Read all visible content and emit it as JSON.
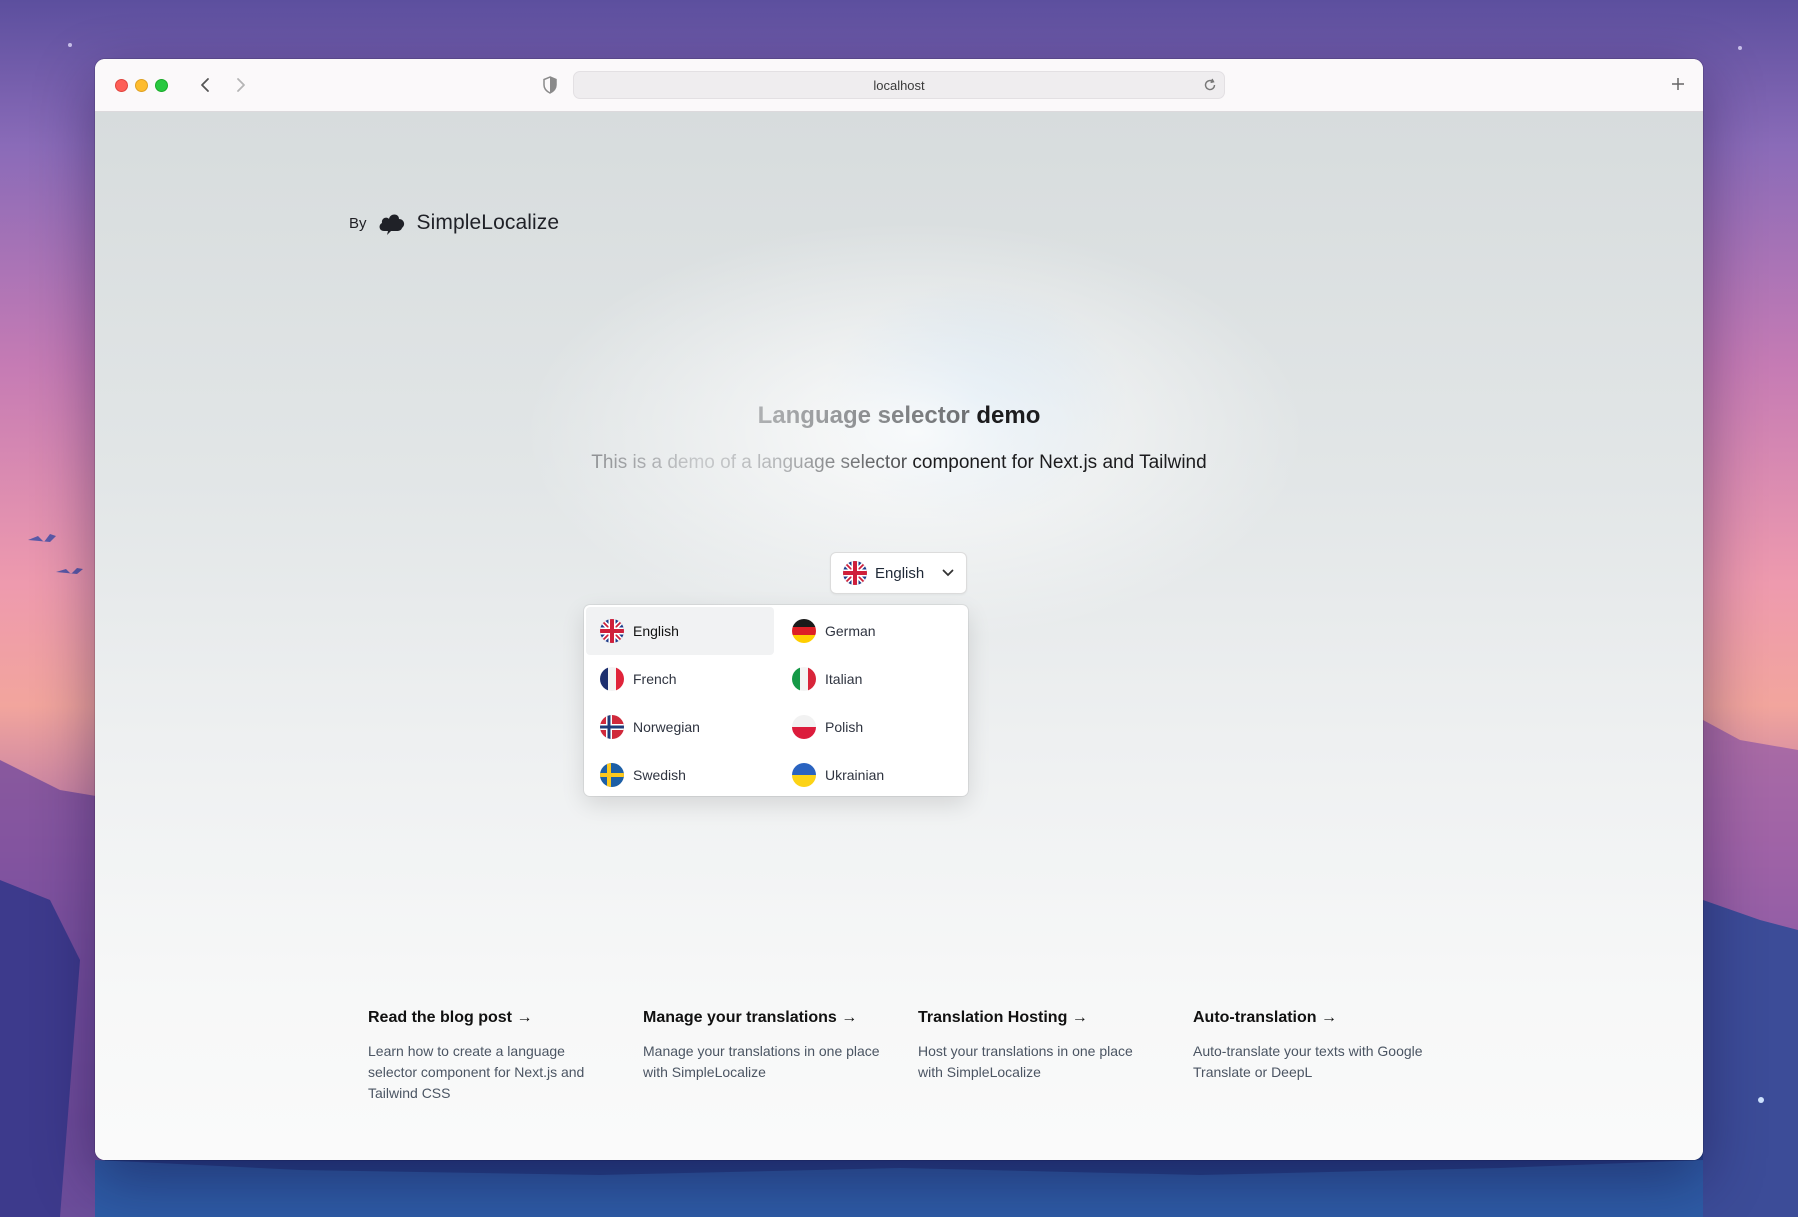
{
  "browser": {
    "url": "localhost",
    "icons": [
      "back-icon",
      "forward-icon",
      "shield-icon",
      "reload-icon",
      "plus-icon"
    ]
  },
  "brand": {
    "by": "By",
    "name": "SimpleLocalize"
  },
  "hero": {
    "title_faded": "Language selector",
    "title_strong": "demo",
    "subtitle_faded": "This is a demo of a language selector",
    "subtitle_strong": "component for Next.js and Tailwind"
  },
  "selector": {
    "current": "English",
    "current_flag": "uk-flag-icon"
  },
  "languages": [
    {
      "label": "English",
      "flag": "uk",
      "active": true
    },
    {
      "label": "German",
      "flag": "de",
      "active": false
    },
    {
      "label": "French",
      "flag": "fr",
      "active": false
    },
    {
      "label": "Italian",
      "flag": "it",
      "active": false
    },
    {
      "label": "Norwegian",
      "flag": "no",
      "active": false
    },
    {
      "label": "Polish",
      "flag": "pl",
      "active": false
    },
    {
      "label": "Swedish",
      "flag": "se",
      "active": false
    },
    {
      "label": "Ukrainian",
      "flag": "ua",
      "active": false
    }
  ],
  "cards": [
    {
      "title": "Read the blog post →",
      "desc": "Learn how to create a language selector component for Next.js and Tailwind CSS"
    },
    {
      "title": "Manage your translations →",
      "desc": "Manage your translations in one place with SimpleLocalize"
    },
    {
      "title": "Translation Hosting →",
      "desc": "Host your translations in one place with SimpleLocalize"
    },
    {
      "title": "Auto-translation →",
      "desc": "Auto-translate your texts with Google Translate or DeepL"
    }
  ],
  "colors": {
    "title_fade_start": "#a7a9ab",
    "title_fade_end": "#1c1c1e",
    "active_item_bg": "#f1f2f3",
    "close": "#fe5f57",
    "minimize": "#febc2e",
    "zoom": "#28c840"
  }
}
